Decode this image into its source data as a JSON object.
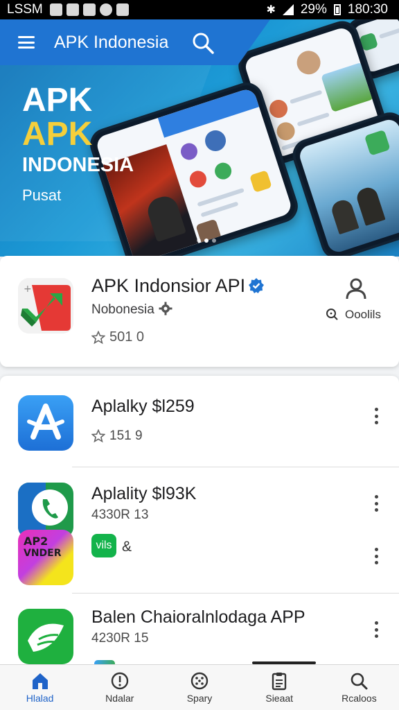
{
  "status_bar": {
    "carrier": "LSSM",
    "battery": "29%",
    "time": "180:30"
  },
  "header": {
    "title": "APK Indonesia"
  },
  "hero": {
    "line1": "APK",
    "line2": "APK",
    "line3": "INDONESIA",
    "line4": "Pusat",
    "slides_total": 3,
    "slide_active": 2
  },
  "featured": {
    "title": "APK Indonsior API",
    "subtitle": "Nobonesia",
    "rating": "501 0",
    "right_label": "Ooolils"
  },
  "apps": [
    {
      "title": "Aplalky $l259",
      "sub": "151 9"
    },
    {
      "title": "Aplality $l93K",
      "sub": "4330R 13",
      "chip": "vils",
      "extra": "&"
    },
    {
      "title": "Balen Chaioralnlodaga APP",
      "sub": "4230R 15"
    }
  ],
  "bottom_nav": [
    {
      "label": "Hlalad",
      "icon": "home-icon",
      "active": true
    },
    {
      "label": "Ndalar",
      "icon": "alert-icon",
      "active": false
    },
    {
      "label": "Spary",
      "icon": "games-icon",
      "active": false
    },
    {
      "label": "Sieaat",
      "icon": "clipboard-icon",
      "active": false
    },
    {
      "label": "Rcaloos",
      "icon": "search-icon",
      "active": false
    }
  ],
  "colors": {
    "accent": "#1f74d2",
    "hero_yellow": "#f5cf3b",
    "active_nav": "#1f63c8"
  }
}
